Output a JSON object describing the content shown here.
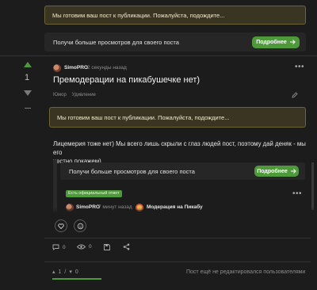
{
  "top_notice": {
    "text": "Мы готовим ваш пост к публикации. Пожалуйста, подождите..."
  },
  "top_promo": {
    "text": "Получи больше просмотров для своего поста",
    "button_label": "Подробнее"
  },
  "post": {
    "rating": "1",
    "author": "SimoPRO",
    "time": "2 секунды назад",
    "title": "Премодерации на пикабушечке нет)",
    "tags": [
      "Юмор",
      "Удивление"
    ],
    "notice": "Мы готовим ваш пост к публикации. Пожалуйста, подождите...",
    "body_line1": "Лицемерия тоже нет) Мы всего лишь скрыли с глаз людей пост, поэтому дай деняк - мы его",
    "body_line2": "честно покажем)"
  },
  "embed": {
    "promo_text": "Получи больше просмотров для своего поста",
    "promo_button": "Подробнее",
    "badge": "Есть официальный ответ",
    "author": "SimoPRO",
    "time": "7 минут назад",
    "community": "Модерация на Пикабу"
  },
  "actions": {
    "comments_count": "0",
    "views_count": "0"
  },
  "footer": {
    "up_votes": "1",
    "down_votes": "0",
    "separator": "/",
    "edit_status": "Пост ещё не редактировался пользователями"
  },
  "colors": {
    "accent": "#4e9a3b",
    "notice_bg": "#3a3422",
    "notice_border": "#6e6335",
    "page_bg": "#1c1c1d"
  }
}
